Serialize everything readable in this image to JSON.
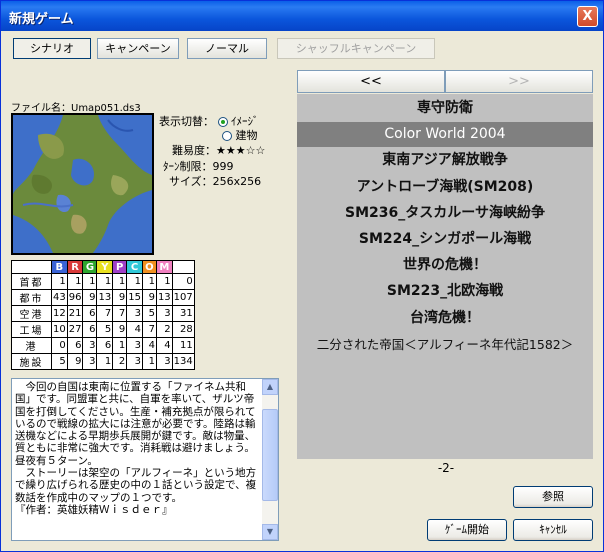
{
  "window": {
    "title": "新規ゲーム",
    "close_glyph": "X"
  },
  "tabs": [
    {
      "label": "シナリオ",
      "state": "active"
    },
    {
      "label": "キャンペーン",
      "state": "normal"
    },
    {
      "label": "ノーマル",
      "state": "normal"
    },
    {
      "label": "シャッフルキャンペーン",
      "state": "disabled"
    }
  ],
  "file": {
    "label": "ファイル名：Umap051.ds3"
  },
  "info": {
    "display_label": "表示切替：",
    "radio_image": "ｲﾒｰｼﾞ",
    "radio_building": "建物",
    "selected": "image",
    "difficulty_label": "難易度：",
    "difficulty_stars": "★★★☆☆",
    "turn_label": "ﾀｰﾝ制限：999",
    "size_label": "サイズ：256x256"
  },
  "stats": {
    "columns": [
      {
        "letter": "B",
        "color": "#3A63D6"
      },
      {
        "letter": "R",
        "color": "#D83A3A"
      },
      {
        "letter": "G",
        "color": "#2EA62E"
      },
      {
        "letter": "Y",
        "color": "#E8E020"
      },
      {
        "letter": "P",
        "color": "#A040C8"
      },
      {
        "letter": "C",
        "color": "#30C8D8"
      },
      {
        "letter": "O",
        "color": "#F09020"
      },
      {
        "letter": "M",
        "color": "#F080C0"
      },
      {
        "letter": "",
        "color": "#FFFFFF"
      }
    ],
    "rows": [
      {
        "label": "首都",
        "values": [
          "1",
          "1",
          "1",
          "1",
          "1",
          "1",
          "1",
          "1",
          "0"
        ]
      },
      {
        "label": "都市",
        "values": [
          "43",
          "96",
          "9",
          "13",
          "9",
          "15",
          "9",
          "13",
          "107"
        ]
      },
      {
        "label": "空港",
        "values": [
          "12",
          "21",
          "6",
          "7",
          "7",
          "3",
          "5",
          "3",
          "31"
        ]
      },
      {
        "label": "工場",
        "values": [
          "10",
          "27",
          "6",
          "5",
          "9",
          "4",
          "7",
          "2",
          "28"
        ]
      },
      {
        "label": "港",
        "values": [
          "0",
          "6",
          "3",
          "6",
          "1",
          "3",
          "4",
          "4",
          "11"
        ]
      },
      {
        "label": "施設",
        "values": [
          "5",
          "9",
          "3",
          "1",
          "2",
          "3",
          "1",
          "3",
          "134"
        ]
      }
    ]
  },
  "description": "　今回の自国は東南に位置する「ファイネム共和国」です。同盟軍と共に、自軍を率いて、ザルツ帝国を打倒してください。生産・補充拠点が限られているので戦線の拡大には注意が必要です。陸路は輸送機などによる早期歩兵展開が鍵です。敵は物量、質ともに非常に強大です。消耗戦は避けましょう。昼夜有５ターン。\n　ストーリーは架空の「アルフィーネ」という地方で繰り広げられる歴史の中の１話という設定で、複数話を作成中のマップの１つです。\n『作者：英雄妖精Ｗｉｓｄｅｒ』",
  "nav": {
    "prev": "<<",
    "next": ">>"
  },
  "scenarios": [
    {
      "title": "専守防衛",
      "style": "bold"
    },
    {
      "title": "Color World 2004",
      "style": "selected"
    },
    {
      "title": "東南アジア解放戦争",
      "style": "bold"
    },
    {
      "title": "アントローブ海戦(SM208)",
      "style": "bold"
    },
    {
      "title": "SM236_タスカルーサ海峡紛争",
      "style": "bold"
    },
    {
      "title": "SM224_シンガポール海戦",
      "style": "bold"
    },
    {
      "title": "世界の危機！",
      "style": "bold"
    },
    {
      "title": "SM223_北欧海戦",
      "style": "bold"
    },
    {
      "title": "台湾危機！",
      "style": "bold"
    },
    {
      "title": "二分された帝国＜アルフィーネ年代記1582＞",
      "style": "plain"
    }
  ],
  "page": "-2-",
  "buttons": {
    "browse": "参照",
    "start": "ｹﾞｰﾑ開始",
    "cancel": "ｷｬﾝｾﾙ"
  }
}
